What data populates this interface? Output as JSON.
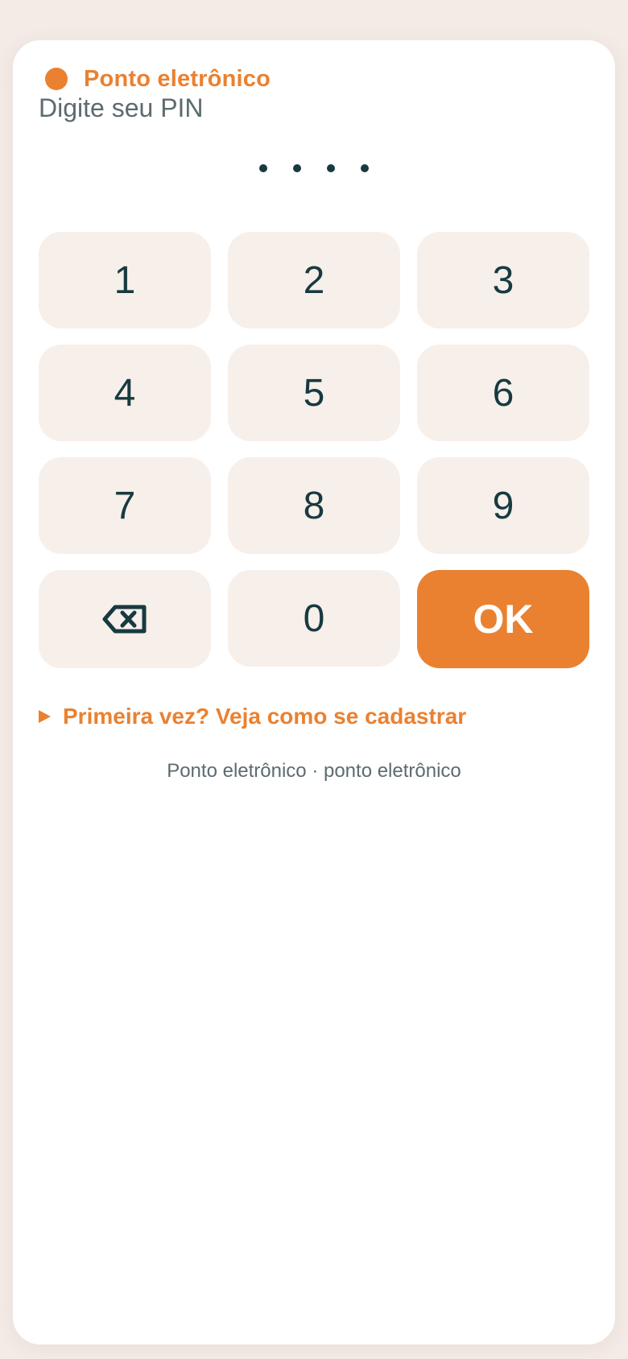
{
  "header": {
    "brand": "Ponto eletrônico",
    "subtitle": "Digite seu PIN"
  },
  "pin": {
    "length": 4,
    "filled": 4
  },
  "keypad": {
    "keys": [
      "1",
      "2",
      "3",
      "4",
      "5",
      "6",
      "7",
      "8",
      "9",
      "0"
    ],
    "backspace_icon": "backspace-icon",
    "ok_label": "OK"
  },
  "help": {
    "label": "Primeira vez? Veja como se cadastrar"
  },
  "footer": {
    "text": "Ponto eletrônico · ponto eletrônico"
  },
  "colors": {
    "accent": "#ea8130",
    "text_dark": "#173a40",
    "text_muted": "#5c6b6f",
    "key_bg": "#f7efea",
    "page_bg": "#f4ebe6"
  }
}
